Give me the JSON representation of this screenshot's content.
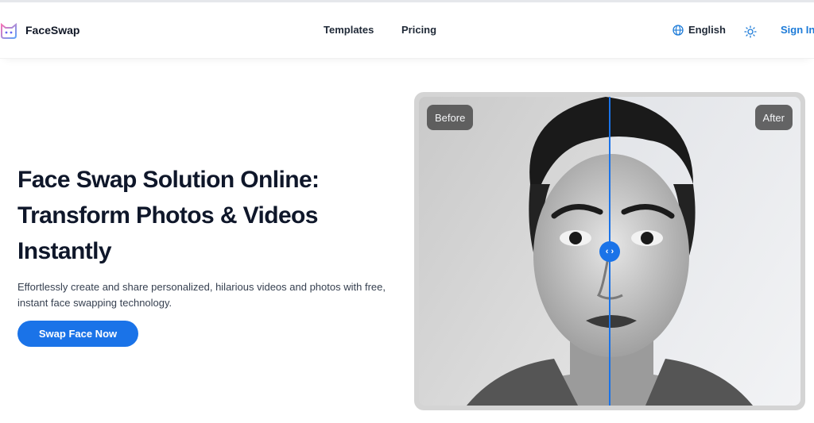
{
  "header": {
    "brand": "FaceSwap",
    "nav": [
      {
        "label": "Templates"
      },
      {
        "label": "Pricing"
      }
    ],
    "language": "English",
    "signin": "Sign In"
  },
  "hero": {
    "title": "Face Swap Solution Online: Transform Photos & Videos Instantly",
    "description": "Effortlessly create and share personalized, hilarious videos and photos with free, instant face swapping technology.",
    "cta": "Swap Face Now"
  },
  "comparison": {
    "before_label": "Before",
    "after_label": "After"
  },
  "colors": {
    "accent": "#1a73e8",
    "signin": "#1d7bd8"
  }
}
